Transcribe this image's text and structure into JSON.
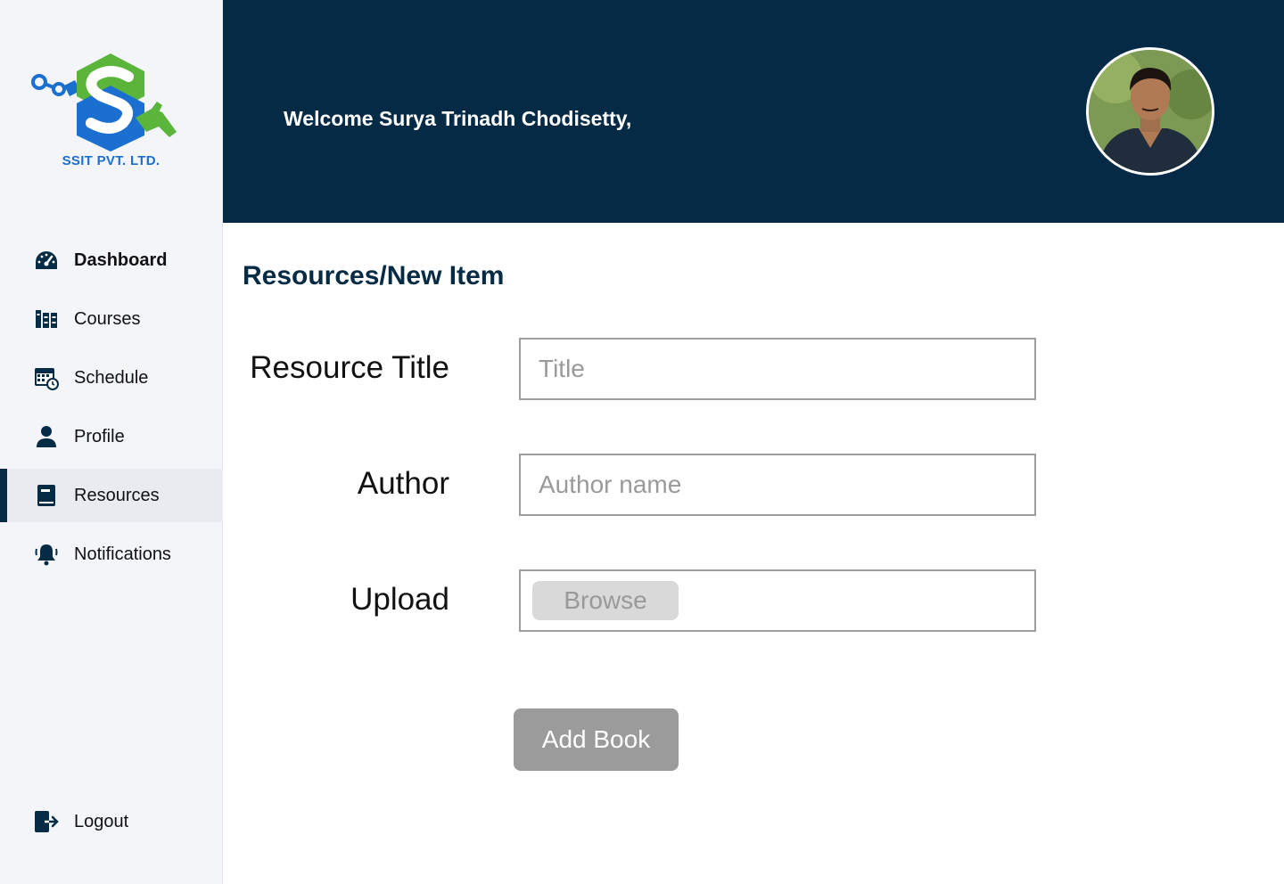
{
  "brand": {
    "name": "SSIT PVT. LTD.",
    "colors": {
      "green": "#5bb53a",
      "blue": "#1a6fd0"
    }
  },
  "header": {
    "welcome": "Welcome Surya Trinadh Chodisetty,",
    "avatar_alt": "user avatar"
  },
  "sidebar": {
    "items": [
      {
        "label": "Dashboard",
        "icon": "dashboard-gauge-icon"
      },
      {
        "label": "Courses",
        "icon": "books-icon"
      },
      {
        "label": "Schedule",
        "icon": "calendar-clock-icon"
      },
      {
        "label": "Profile",
        "icon": "person-icon"
      },
      {
        "label": "Resources",
        "icon": "book-icon"
      },
      {
        "label": "Notifications",
        "icon": "bell-icon"
      }
    ],
    "logout": {
      "label": "Logout",
      "icon": "logout-icon"
    }
  },
  "main": {
    "title": "Resources/New Item",
    "form": {
      "title_label": "Resource Title",
      "title_placeholder": "Title",
      "author_label": "Author",
      "author_placeholder": "Author name",
      "upload_label": "Upload",
      "browse_label": "Browse",
      "submit_label": "Add Book"
    }
  },
  "colors": {
    "primary": "#042a45",
    "sidebar_bg": "#f3f5f8",
    "button_disabled": "#9b9b9b"
  }
}
